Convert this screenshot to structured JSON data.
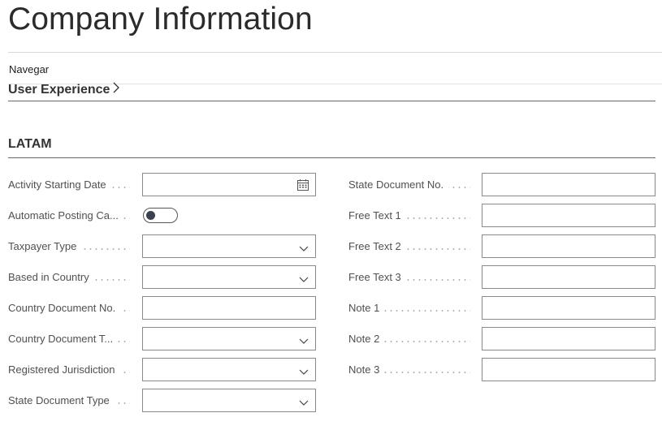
{
  "page": {
    "title": "Company Information"
  },
  "nav": {
    "label": "Navegar"
  },
  "sections": {
    "user_experience": {
      "title": "User Experience"
    },
    "latam": {
      "title": "LATAM"
    }
  },
  "left_fields": [
    {
      "label": "Activity Starting Date",
      "type": "date",
      "value": ""
    },
    {
      "label": "Automatic Posting Ca...",
      "type": "toggle",
      "value": "off"
    },
    {
      "label": "Taxpayer Type",
      "type": "select",
      "value": ""
    },
    {
      "label": "Based in Country",
      "type": "select",
      "value": ""
    },
    {
      "label": "Country Document No.",
      "type": "text",
      "value": ""
    },
    {
      "label": "Country Document T...",
      "type": "select",
      "value": ""
    },
    {
      "label": "Registered Jurisdiction",
      "type": "select",
      "value": ""
    },
    {
      "label": "State Document Type",
      "type": "select",
      "value": ""
    }
  ],
  "right_fields": [
    {
      "label": "State Document No.",
      "type": "text",
      "value": ""
    },
    {
      "label": "Free Text 1",
      "type": "text",
      "value": ""
    },
    {
      "label": "Free Text 2",
      "type": "text",
      "value": ""
    },
    {
      "label": "Free Text 3",
      "type": "text",
      "value": ""
    },
    {
      "label": "Note 1",
      "type": "text",
      "value": ""
    },
    {
      "label": "Note 2",
      "type": "text",
      "value": ""
    },
    {
      "label": "Note 3",
      "type": "text",
      "value": ""
    }
  ],
  "icons": {
    "calendar": "calendar-icon",
    "dropdown": "chevron-down-icon",
    "section_expand": "chevron-right-icon"
  },
  "colors": {
    "border": "#8a8a8a",
    "toggle_knob": "#3c4150",
    "section_rule": "#6a6a6a"
  }
}
